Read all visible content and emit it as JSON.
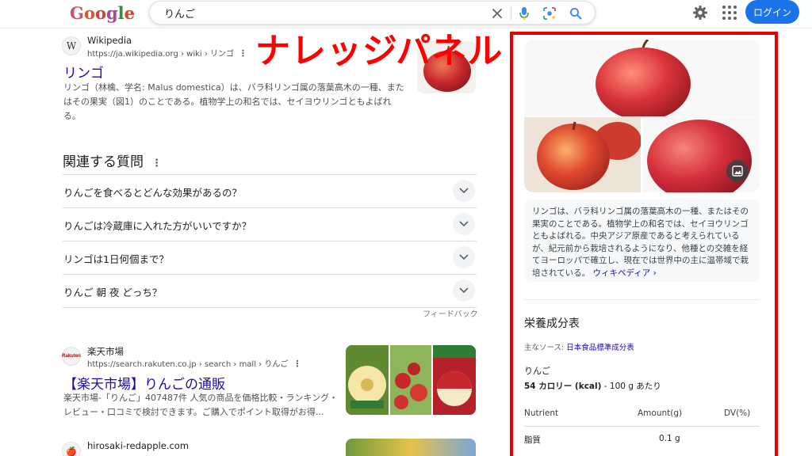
{
  "header": {
    "logo_letters": [
      "G",
      "o",
      "o",
      "g",
      "l",
      "e"
    ],
    "logo_colors": [
      "#d0506a",
      "#e0572c",
      "#c7463d",
      "#a34a9a",
      "#3d8b3d",
      "#d9442d"
    ],
    "search_value": "りんご",
    "login_label": "ログイン"
  },
  "overlay_title": "ナレッジパネル",
  "results": [
    {
      "site": "Wikipedia",
      "url": "https://ja.wikipedia.org › wiki › リンゴ",
      "favicon": "W",
      "title": "リンゴ",
      "snippet": "リンゴ（林檎、学名: Malus domestica）は、バラ科リンゴ属の落葉高木の一種、またはその果実（図1）のことである。植物学上の和名では、セイヨウリンゴともよばれる。"
    },
    {
      "site": "楽天市場",
      "url": "https://search.rakuten.co.jp › search › mall › りんご",
      "favicon": "Rakuten",
      "title": "【楽天市場】りんごの通販",
      "snippet": "楽天市場-「りんご」407487件 人気の商品を価格比較・ランキング・レビュー・口コミで検討できます。ご購入でポイント取得がお得..."
    },
    {
      "site": "hirosaki-redapple.com",
      "favicon": "🍎"
    }
  ],
  "related": {
    "title": "関連する質問",
    "questions": [
      "りんごを食べるとどんな効果があるの？",
      "りんごは冷蔵庫に入れた方がいいですか？",
      "リンゴは1日何個まで？",
      "りんご 朝 夜 どっち？"
    ],
    "feedback": "フィードバック"
  },
  "knowledge_panel": {
    "description": "リンゴは、バラ科リンゴ属の落葉高木の一種、またはその果実のことである。植物学上の和名では、セイヨウリンゴともよばれる。中央アジア原産であると考えられているが、紀元前から栽培されるようになり、他種との交雑を経てヨーロッパで確立し、現在では世界中の主に温帯域で栽培されている。",
    "wiki_link": "ウィキペディア ›",
    "nutrition": {
      "title": "栄養成分表",
      "source_label": "主なソース:",
      "source_link": "日本食品標準成分表",
      "food": "りんご",
      "calories": "54 カロリー (kcal)",
      "per": " - 100 g あたり",
      "headers": [
        "Nutrient",
        "Amount(g)",
        "DV(%)"
      ],
      "rows": [
        {
          "nutrient": "脂質",
          "amount": "0.1 g",
          "dv": ""
        }
      ]
    }
  },
  "colors": {
    "accent": "#1a73e8",
    "link": "#1a0dab",
    "highlight": "#e60000"
  }
}
